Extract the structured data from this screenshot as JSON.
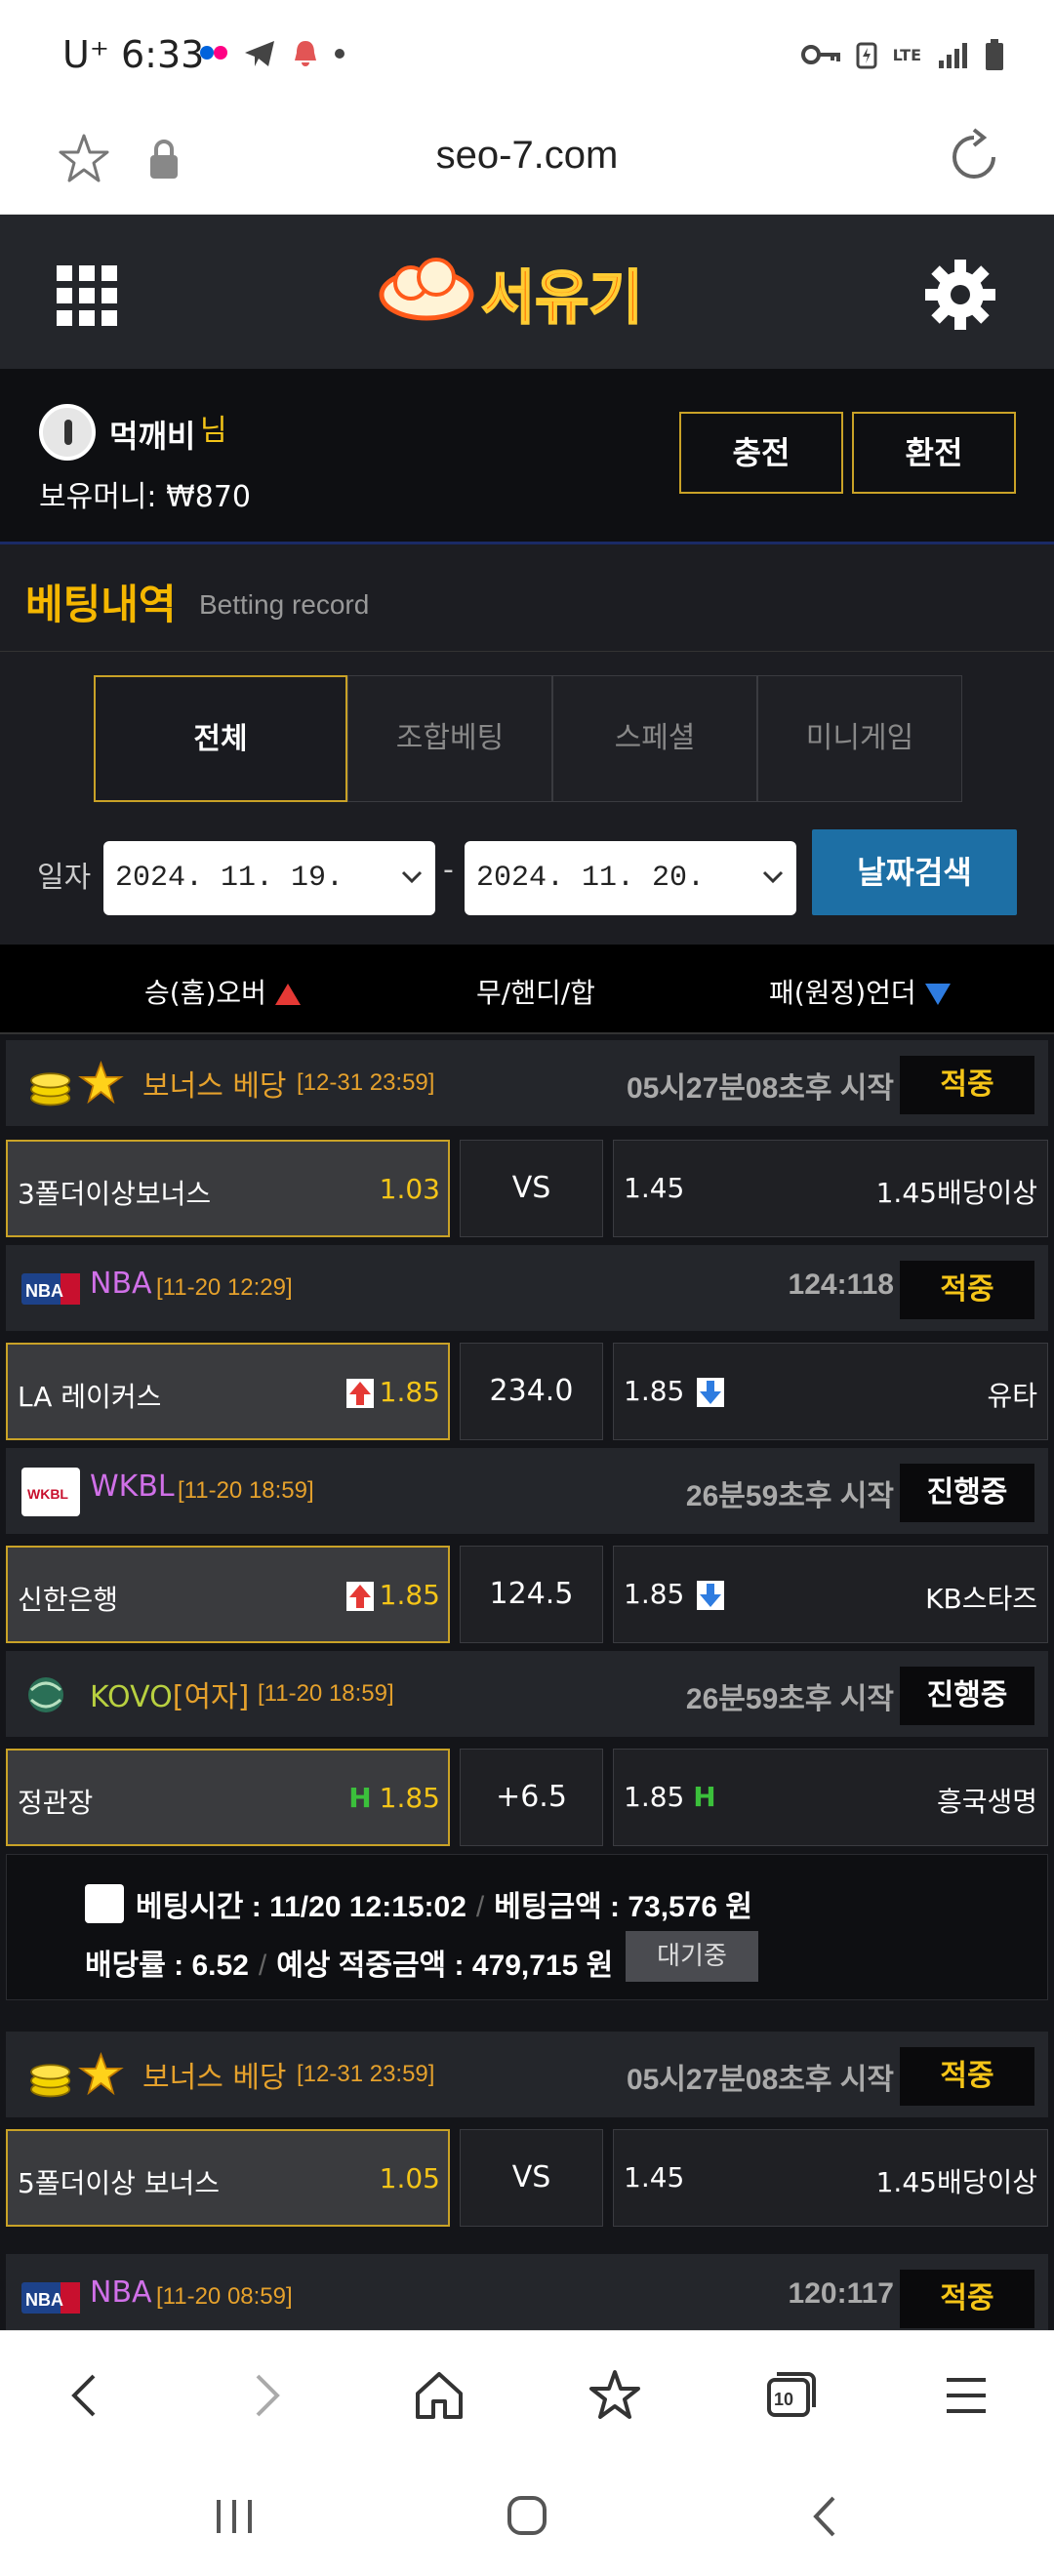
{
  "status_bar": {
    "time": "6:33",
    "carrier": "U⁺",
    "network": "LTE"
  },
  "browser": {
    "url": "seo-7.com"
  },
  "site": {
    "logo_text": "서유기"
  },
  "user": {
    "name": "먹깨비",
    "suffix": "님",
    "money_label": "보유머니:",
    "money_value": "₩870",
    "charge_label": "충전",
    "exchange_label": "환전"
  },
  "page": {
    "title_ko": "베팅내역",
    "title_en": "Betting record"
  },
  "tabs": [
    {
      "label": "전체",
      "active": true
    },
    {
      "label": "조합베팅",
      "active": false
    },
    {
      "label": "스페셜",
      "active": false
    },
    {
      "label": "미니게임",
      "active": false
    }
  ],
  "filter": {
    "date_label": "일자",
    "date_from": "2024. 11. 19.",
    "date_to": "2024. 11. 20.",
    "dash": "-",
    "search_label": "날짜검색"
  },
  "columns": {
    "home": "승(홈)오버",
    "mid": "무/핸디/합",
    "away": "패(원정)언더"
  },
  "games": [
    {
      "league": "보너스 베당",
      "league_color": "#e5a12c",
      "league_time": "[12-31 23:59]",
      "status": "05시27분08초후 시작",
      "badge": "적중",
      "badge_color": "#f5c518",
      "home_team": "3폴더이상보너스",
      "home_rate": "1.03",
      "mid": "VS",
      "away_rate": "1.45",
      "away_team": "1.45배당이상"
    },
    {
      "league": "NBA",
      "league_color": "#d070e8",
      "league_time": "[11-20 12:29]",
      "status": "124:118",
      "badge": "적중",
      "badge_color": "#f5c518",
      "home_team": "LA 레이커스",
      "home_rate": "1.85",
      "mid": "234.0",
      "away_rate": "1.85",
      "away_team": "유타"
    },
    {
      "league": "WKBL",
      "league_color": "#d070e8",
      "league_time": "[11-20 18:59]",
      "status": "26분59초후 시작",
      "badge": "진행중",
      "badge_color": "#ffffff",
      "home_team": "신한은행",
      "home_rate": "1.85",
      "mid": "124.5",
      "away_rate": "1.85",
      "away_team": "KB스타즈"
    },
    {
      "league": "KOVO",
      "league_sub": "[여자]",
      "league_color": "#b8d040",
      "league_time": "[11-20 18:59]",
      "status": "26분59초후 시작",
      "badge": "진행중",
      "badge_color": "#ffffff",
      "home_team": "정관장",
      "home_rate": "1.85",
      "mid": "+6.5",
      "away_rate": "1.85",
      "away_team": "흥국생명"
    }
  ],
  "bet_summary": {
    "time_label": "베팅시간 :",
    "time_value": "11/20 12:15:02",
    "amount_label": "베팅금액 :",
    "amount_value": "73,576 원",
    "rate_label": "배당률 :",
    "rate_value": "6.52",
    "expected_label": "예상 적중금액 :",
    "expected_value": "479,715 원",
    "status_label": "대기중"
  },
  "games2": [
    {
      "league": "보너스 베당",
      "league_time": "[12-31 23:59]",
      "status": "05시27분08초후 시작",
      "badge": "적중",
      "home_team": "5폴더이상 보너스",
      "home_rate": "1.05",
      "mid": "VS",
      "away_rate": "1.45",
      "away_team": "1.45배당이상"
    },
    {
      "league": "NBA",
      "league_time": "[11-20 08:59]",
      "status": "120:117",
      "badge": "적중"
    }
  ],
  "icons": {
    "star": "star-icon",
    "lock": "lock-icon",
    "reload": "reload-icon",
    "grid": "grid-menu-icon",
    "gear": "gear-icon",
    "coin": "coin-icon",
    "up_arrow": "up-arrow-icon",
    "down_arrow": "down-arrow-icon"
  },
  "colors": {
    "accent_gold": "#f5c518",
    "border_gold": "#c9a227",
    "search_blue": "#1d6fa5",
    "bg_dark": "#141519"
  }
}
